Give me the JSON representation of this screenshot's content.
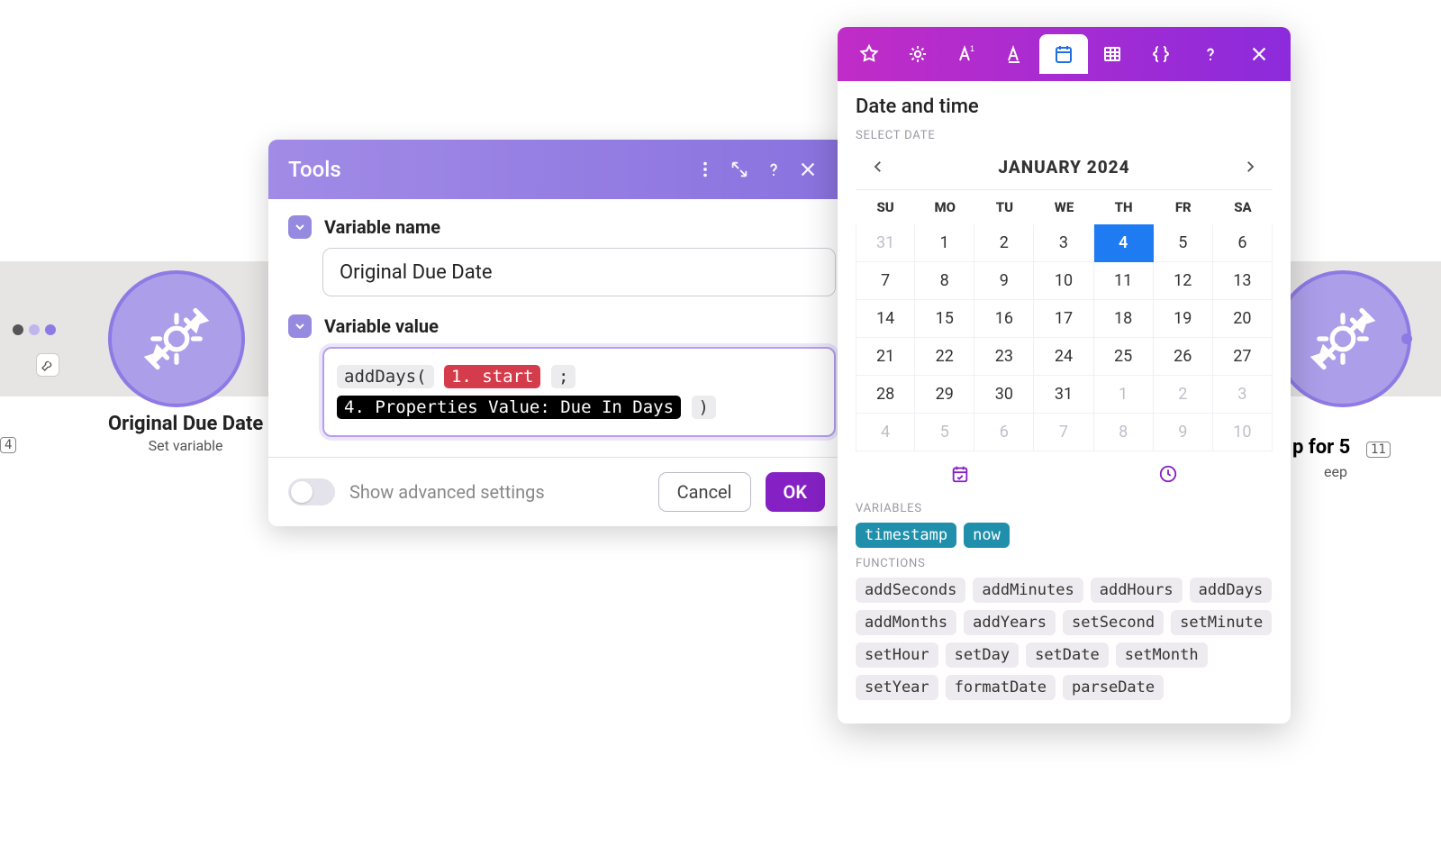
{
  "background": {
    "node_left": {
      "label": "Original Due Date",
      "sub": "Set variable",
      "tag": "4"
    },
    "node_right": {
      "label_fragment": "p for 5",
      "sub_fragment": "eep",
      "tag": "11"
    }
  },
  "tools": {
    "title": "Tools",
    "variable_name_label": "Variable name",
    "variable_name_value": "Original Due Date",
    "variable_value_label": "Variable value",
    "expression": {
      "fn_open": "addDays(",
      "token_red": "1. start",
      "sep": ";",
      "token_black": "4. Properties Value: Due In Days",
      "fn_close": ")"
    },
    "advanced_toggle_label": "Show advanced settings",
    "cancel": "Cancel",
    "ok": "OK"
  },
  "picker": {
    "title": "Date and time",
    "select_date": "SELECT DATE",
    "month": "JANUARY 2024",
    "weekdays": [
      "SU",
      "MO",
      "TU",
      "WE",
      "TH",
      "FR",
      "SA"
    ],
    "weeks": [
      [
        {
          "d": "31",
          "muted": true
        },
        {
          "d": "1"
        },
        {
          "d": "2"
        },
        {
          "d": "3"
        },
        {
          "d": "4",
          "selected": true
        },
        {
          "d": "5"
        },
        {
          "d": "6"
        }
      ],
      [
        {
          "d": "7"
        },
        {
          "d": "8"
        },
        {
          "d": "9"
        },
        {
          "d": "10"
        },
        {
          "d": "11"
        },
        {
          "d": "12"
        },
        {
          "d": "13"
        }
      ],
      [
        {
          "d": "14"
        },
        {
          "d": "15"
        },
        {
          "d": "16"
        },
        {
          "d": "17"
        },
        {
          "d": "18"
        },
        {
          "d": "19"
        },
        {
          "d": "20"
        }
      ],
      [
        {
          "d": "21"
        },
        {
          "d": "22"
        },
        {
          "d": "23"
        },
        {
          "d": "24"
        },
        {
          "d": "25"
        },
        {
          "d": "26"
        },
        {
          "d": "27"
        }
      ],
      [
        {
          "d": "28"
        },
        {
          "d": "29"
        },
        {
          "d": "30"
        },
        {
          "d": "31"
        },
        {
          "d": "1",
          "muted": true
        },
        {
          "d": "2",
          "muted": true
        },
        {
          "d": "3",
          "muted": true
        }
      ],
      [
        {
          "d": "4",
          "muted": true
        },
        {
          "d": "5",
          "muted": true
        },
        {
          "d": "6",
          "muted": true
        },
        {
          "d": "7",
          "muted": true
        },
        {
          "d": "8",
          "muted": true
        },
        {
          "d": "9",
          "muted": true
        },
        {
          "d": "10",
          "muted": true
        }
      ]
    ],
    "variables_label": "VARIABLES",
    "variables": [
      "timestamp",
      "now"
    ],
    "functions_label": "FUNCTIONS",
    "functions": [
      "addSeconds",
      "addMinutes",
      "addHours",
      "addDays",
      "addMonths",
      "addYears",
      "setSecond",
      "setMinute",
      "setHour",
      "setDay",
      "setDate",
      "setMonth",
      "setYear",
      "formatDate",
      "parseDate"
    ]
  }
}
